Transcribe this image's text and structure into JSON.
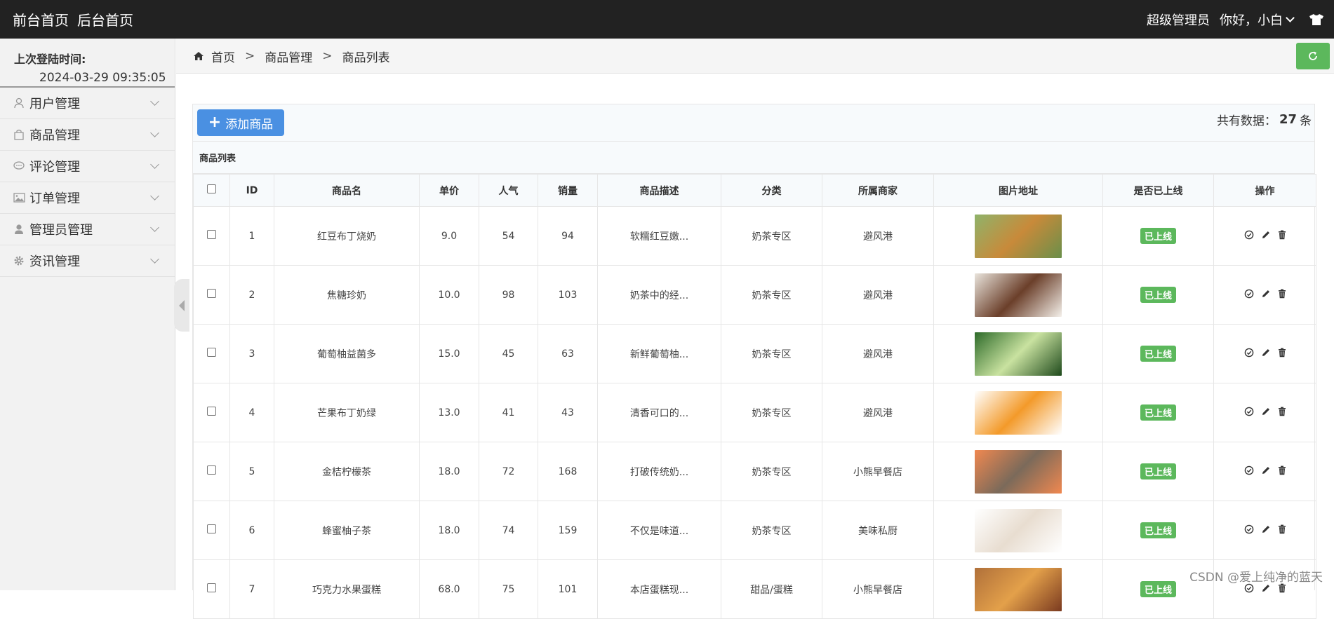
{
  "topbar": {
    "front_home": "前台首页",
    "back_home": "后台首页",
    "role": "超级管理员",
    "greeting": "你好，小白"
  },
  "sidebar": {
    "last_login_label": "上次登陆时间:",
    "last_login_value": "2024-03-29 09:35:05",
    "items": [
      {
        "label": "用户管理",
        "icon": "user-icon"
      },
      {
        "label": "商品管理",
        "icon": "shopping-bag-icon"
      },
      {
        "label": "评论管理",
        "icon": "comment-icon"
      },
      {
        "label": "订单管理",
        "icon": "picture-icon"
      },
      {
        "label": "管理员管理",
        "icon": "admin-user-icon"
      },
      {
        "label": "资讯管理",
        "icon": "gear-icon"
      }
    ]
  },
  "breadcrumb": {
    "home": "首页",
    "level1": "商品管理",
    "level2": "商品列表",
    "separator": ">"
  },
  "toolbar": {
    "add_label": "添加商品",
    "count_prefix": "共有数据：",
    "count_value": "27",
    "count_suffix": "条"
  },
  "table": {
    "title": "商品列表",
    "headers": {
      "id": "ID",
      "name": "商品名",
      "price": "单价",
      "popularity": "人气",
      "sales": "销量",
      "desc": "商品描述",
      "category": "分类",
      "merchant": "所属商家",
      "image": "图片地址",
      "online": "是否已上线",
      "ops": "操作"
    },
    "rows": [
      {
        "id": "1",
        "name": "红豆布丁烧奶",
        "price": "9.0",
        "popularity": "54",
        "sales": "94",
        "desc": "软糯红豆嫩...",
        "category": "奶茶专区",
        "merchant": "避风港",
        "online": "已上线",
        "colors": [
          "#8fb36a",
          "#c88a3a",
          "#6a8f4a"
        ]
      },
      {
        "id": "2",
        "name": "焦糖珍奶",
        "price": "10.0",
        "popularity": "98",
        "sales": "103",
        "desc": "奶茶中的经...",
        "category": "奶茶专区",
        "merchant": "避风港",
        "online": "已上线",
        "colors": [
          "#e9e4dc",
          "#6b3f2a",
          "#f4f0ea"
        ]
      },
      {
        "id": "3",
        "name": "葡萄柚益菌多",
        "price": "15.0",
        "popularity": "45",
        "sales": "63",
        "desc": "新鲜葡萄柚...",
        "category": "奶茶专区",
        "merchant": "避风港",
        "online": "已上线",
        "colors": [
          "#2e6b2a",
          "#c9e2a0",
          "#1f4a1c"
        ]
      },
      {
        "id": "4",
        "name": "芒果布丁奶绿",
        "price": "13.0",
        "popularity": "41",
        "sales": "43",
        "desc": "清香可口的...",
        "category": "奶茶专区",
        "merchant": "避风港",
        "online": "已上线",
        "colors": [
          "#ffffff",
          "#f39a2a",
          "#ffffff"
        ]
      },
      {
        "id": "5",
        "name": "金桔柠檬茶",
        "price": "18.0",
        "popularity": "72",
        "sales": "168",
        "desc": "打破传统奶...",
        "category": "奶茶专区",
        "merchant": "小熊早餐店",
        "online": "已上线",
        "colors": [
          "#f08850",
          "#7b6a5a",
          "#f08850"
        ]
      },
      {
        "id": "6",
        "name": "蜂蜜柚子茶",
        "price": "18.0",
        "popularity": "74",
        "sales": "159",
        "desc": "不仅是味道...",
        "category": "奶茶专区",
        "merchant": "美味私厨",
        "online": "已上线",
        "colors": [
          "#ffffff",
          "#e8ddd0",
          "#ffffff"
        ]
      },
      {
        "id": "7",
        "name": "巧克力水果蛋糕",
        "price": "68.0",
        "popularity": "75",
        "sales": "101",
        "desc": "本店蛋糕现...",
        "category": "甜品/蛋糕",
        "merchant": "小熊早餐店",
        "online": "已上线",
        "colors": [
          "#b0703a",
          "#e3a04a",
          "#7a3a20"
        ]
      }
    ]
  },
  "watermark": "CSDN @爱上纯净的蓝天",
  "colors": {
    "topbar_bg": "#222222",
    "accent_blue": "#4a90e2",
    "success_green": "#5cb85c"
  }
}
